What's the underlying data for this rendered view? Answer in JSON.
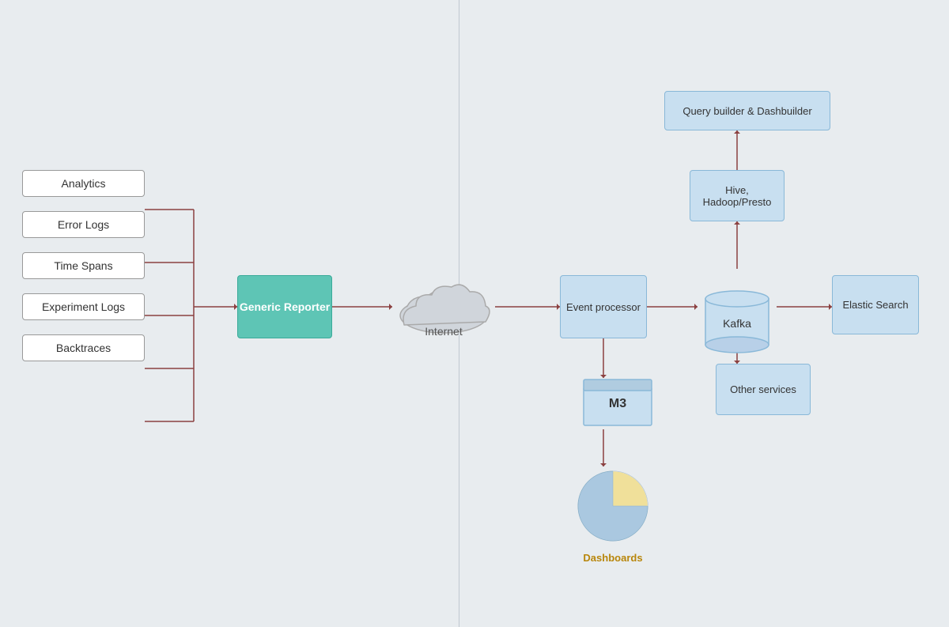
{
  "nodes": {
    "analytics": "Analytics",
    "error_logs": "Error Logs",
    "time_spans": "Time Spans",
    "experiment_logs": "Experiment Logs",
    "backtraces": "Backtraces",
    "generic_reporter": "Generic Reporter",
    "internet": "Internet",
    "event_processor": "Event processor",
    "kafka": "Kafka",
    "elastic_search": "Elastic Search",
    "query_builder": "Query builder & Dashbuilder",
    "hive_hadoop": "Hive,\nHadoop/Presto",
    "other_services": "Other services",
    "m3": "M3",
    "dashboards": "Dashboards"
  },
  "colors": {
    "background": "#e8ecef",
    "teal": "#5ec5b5",
    "blue_node": "#c8dff0",
    "white_node": "#ffffff",
    "divider": "#c0c8d0",
    "connector": "#8b4040",
    "dashboards_label": "#b8860b"
  }
}
